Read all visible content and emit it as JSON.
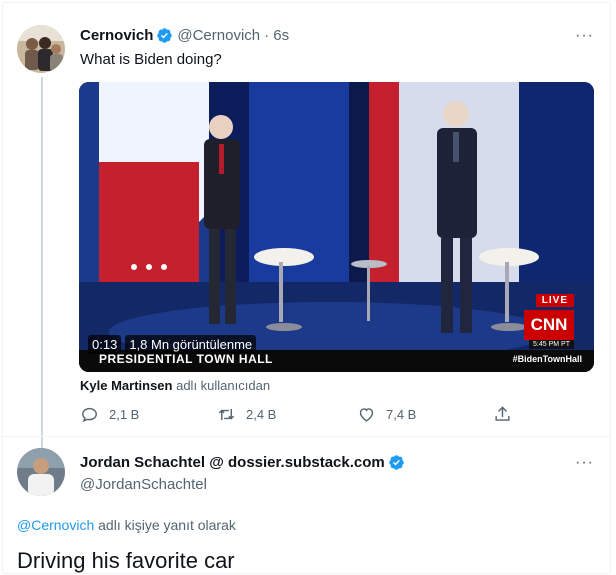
{
  "tweet1": {
    "display_name": "Cernovich",
    "handle": "@Cernovich",
    "time": "· 6s",
    "text": "What is Biden doing?",
    "media": {
      "duration": "0:13",
      "views": "1,8 Mn görüntülenme",
      "banner": "PRESIDENTIAL TOWN HALL",
      "hashtag": "#BidenTownHall",
      "live_badge": "LIVE",
      "network": "CNN",
      "clock": "5:45 PM PT"
    },
    "attribution_name": "Kyle Martinsen",
    "attribution_suffix": " adlı kullanıcıdan",
    "replies": "2,1 B",
    "retweets": "2,4 B",
    "likes": "7,4 B",
    "more_label": "···"
  },
  "tweet2": {
    "display_name": "Jordan Schachtel @ dossier.substack.com",
    "handle": "@JordanSchachtel",
    "reply_mention": "@Cernovich",
    "reply_suffix": " adlı kişiye yanıt olarak",
    "text": "Driving his favorite car",
    "more_label": "···"
  },
  "colors": {
    "accent": "#1d9bf0",
    "muted": "#536471",
    "text": "#0f1419"
  }
}
